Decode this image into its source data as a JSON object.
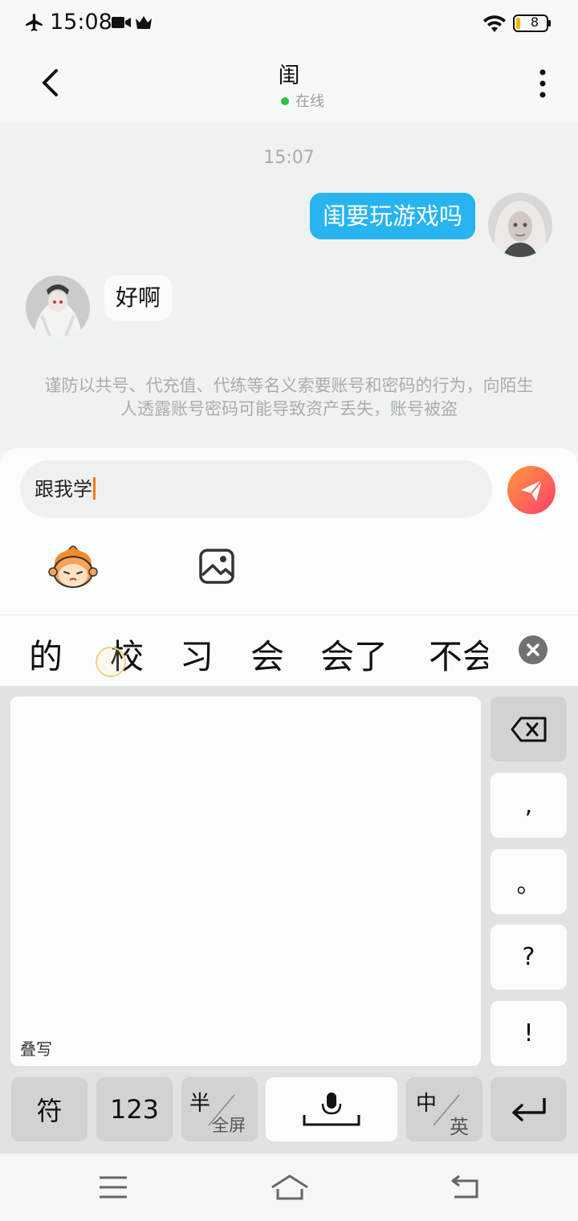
{
  "status_bar": {
    "time": "15:08",
    "battery": "8"
  },
  "header": {
    "title": "闺",
    "status": "在线",
    "back_icon": "back-chevron-icon",
    "more_icon": "more-vertical-icon"
  },
  "chat": {
    "timestamp": "15:07",
    "messages": [
      {
        "from": "me",
        "text": "闺要玩游戏吗"
      },
      {
        "from": "other",
        "text": "好啊"
      }
    ],
    "notice": "谨防以共号、代充值、代练等名义索要账号和密码的行为，向陌生人透露账号密码可能导致资产丢失，账号被盗"
  },
  "input": {
    "text": "跟我学",
    "send_icon": "send-icon",
    "emoji_icon": "emoji-mascot-icon",
    "image_icon": "image-icon"
  },
  "candidates": [
    "的",
    "校",
    "习",
    "会",
    "会了",
    "不会"
  ],
  "keyboard": {
    "handwriting_label": "叠写",
    "punct": [
      ",",
      "。",
      "?",
      "!"
    ],
    "keys": {
      "symbols": "符",
      "numbers": "123",
      "half": "半",
      "full": "全屏",
      "zh": "中",
      "en": "英"
    }
  },
  "colors": {
    "accent_blue": "#27b4f0",
    "online_green": "#2ec24a",
    "send_gradient_start": "#ff9a3c",
    "send_gradient_end": "#ff3f6c"
  }
}
